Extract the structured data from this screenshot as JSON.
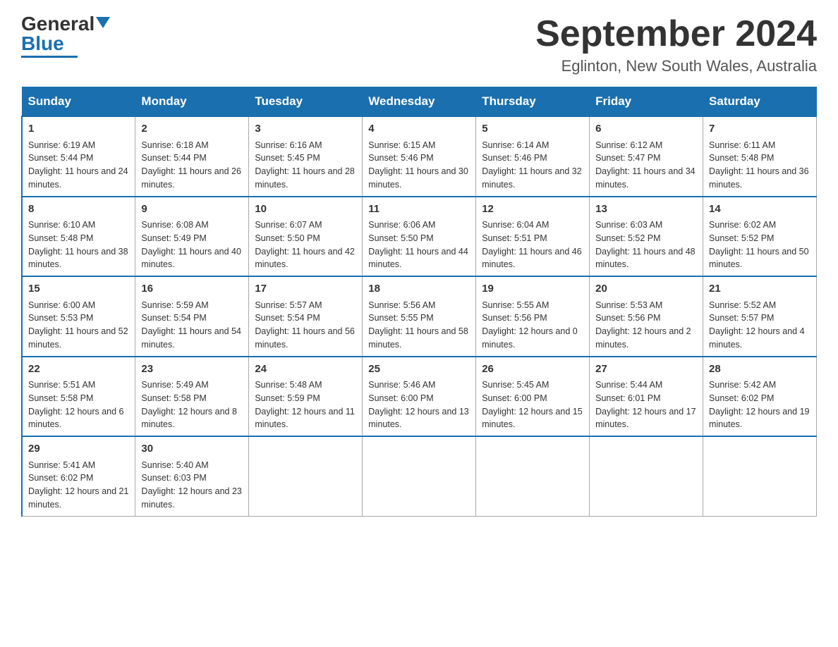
{
  "header": {
    "logo_general": "General",
    "logo_blue": "Blue",
    "month_title": "September 2024",
    "location": "Eglinton, New South Wales, Australia"
  },
  "weekdays": [
    "Sunday",
    "Monday",
    "Tuesday",
    "Wednesday",
    "Thursday",
    "Friday",
    "Saturday"
  ],
  "weeks": [
    [
      {
        "day": "1",
        "sunrise": "6:19 AM",
        "sunset": "5:44 PM",
        "daylight": "11 hours and 24 minutes."
      },
      {
        "day": "2",
        "sunrise": "6:18 AM",
        "sunset": "5:44 PM",
        "daylight": "11 hours and 26 minutes."
      },
      {
        "day": "3",
        "sunrise": "6:16 AM",
        "sunset": "5:45 PM",
        "daylight": "11 hours and 28 minutes."
      },
      {
        "day": "4",
        "sunrise": "6:15 AM",
        "sunset": "5:46 PM",
        "daylight": "11 hours and 30 minutes."
      },
      {
        "day": "5",
        "sunrise": "6:14 AM",
        "sunset": "5:46 PM",
        "daylight": "11 hours and 32 minutes."
      },
      {
        "day": "6",
        "sunrise": "6:12 AM",
        "sunset": "5:47 PM",
        "daylight": "11 hours and 34 minutes."
      },
      {
        "day": "7",
        "sunrise": "6:11 AM",
        "sunset": "5:48 PM",
        "daylight": "11 hours and 36 minutes."
      }
    ],
    [
      {
        "day": "8",
        "sunrise": "6:10 AM",
        "sunset": "5:48 PM",
        "daylight": "11 hours and 38 minutes."
      },
      {
        "day": "9",
        "sunrise": "6:08 AM",
        "sunset": "5:49 PM",
        "daylight": "11 hours and 40 minutes."
      },
      {
        "day": "10",
        "sunrise": "6:07 AM",
        "sunset": "5:50 PM",
        "daylight": "11 hours and 42 minutes."
      },
      {
        "day": "11",
        "sunrise": "6:06 AM",
        "sunset": "5:50 PM",
        "daylight": "11 hours and 44 minutes."
      },
      {
        "day": "12",
        "sunrise": "6:04 AM",
        "sunset": "5:51 PM",
        "daylight": "11 hours and 46 minutes."
      },
      {
        "day": "13",
        "sunrise": "6:03 AM",
        "sunset": "5:52 PM",
        "daylight": "11 hours and 48 minutes."
      },
      {
        "day": "14",
        "sunrise": "6:02 AM",
        "sunset": "5:52 PM",
        "daylight": "11 hours and 50 minutes."
      }
    ],
    [
      {
        "day": "15",
        "sunrise": "6:00 AM",
        "sunset": "5:53 PM",
        "daylight": "11 hours and 52 minutes."
      },
      {
        "day": "16",
        "sunrise": "5:59 AM",
        "sunset": "5:54 PM",
        "daylight": "11 hours and 54 minutes."
      },
      {
        "day": "17",
        "sunrise": "5:57 AM",
        "sunset": "5:54 PM",
        "daylight": "11 hours and 56 minutes."
      },
      {
        "day": "18",
        "sunrise": "5:56 AM",
        "sunset": "5:55 PM",
        "daylight": "11 hours and 58 minutes."
      },
      {
        "day": "19",
        "sunrise": "5:55 AM",
        "sunset": "5:56 PM",
        "daylight": "12 hours and 0 minutes."
      },
      {
        "day": "20",
        "sunrise": "5:53 AM",
        "sunset": "5:56 PM",
        "daylight": "12 hours and 2 minutes."
      },
      {
        "day": "21",
        "sunrise": "5:52 AM",
        "sunset": "5:57 PM",
        "daylight": "12 hours and 4 minutes."
      }
    ],
    [
      {
        "day": "22",
        "sunrise": "5:51 AM",
        "sunset": "5:58 PM",
        "daylight": "12 hours and 6 minutes."
      },
      {
        "day": "23",
        "sunrise": "5:49 AM",
        "sunset": "5:58 PM",
        "daylight": "12 hours and 8 minutes."
      },
      {
        "day": "24",
        "sunrise": "5:48 AM",
        "sunset": "5:59 PM",
        "daylight": "12 hours and 11 minutes."
      },
      {
        "day": "25",
        "sunrise": "5:46 AM",
        "sunset": "6:00 PM",
        "daylight": "12 hours and 13 minutes."
      },
      {
        "day": "26",
        "sunrise": "5:45 AM",
        "sunset": "6:00 PM",
        "daylight": "12 hours and 15 minutes."
      },
      {
        "day": "27",
        "sunrise": "5:44 AM",
        "sunset": "6:01 PM",
        "daylight": "12 hours and 17 minutes."
      },
      {
        "day": "28",
        "sunrise": "5:42 AM",
        "sunset": "6:02 PM",
        "daylight": "12 hours and 19 minutes."
      }
    ],
    [
      {
        "day": "29",
        "sunrise": "5:41 AM",
        "sunset": "6:02 PM",
        "daylight": "12 hours and 21 minutes."
      },
      {
        "day": "30",
        "sunrise": "5:40 AM",
        "sunset": "6:03 PM",
        "daylight": "12 hours and 23 minutes."
      },
      null,
      null,
      null,
      null,
      null
    ]
  ]
}
